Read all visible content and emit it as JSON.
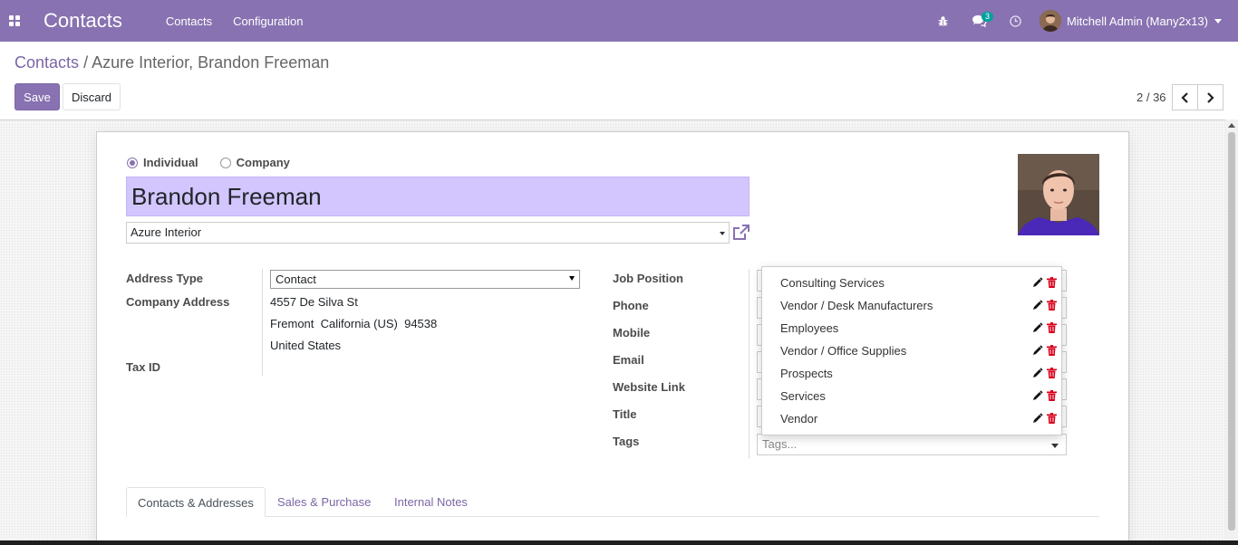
{
  "app": {
    "title": "Contacts",
    "menu": [
      "Contacts",
      "Configuration"
    ],
    "messages_count": "3",
    "user": "Mitchell Admin (Many2x13)"
  },
  "breadcrumb": {
    "root": "Contacts",
    "separator": "/",
    "current": "Azure Interior, Brandon Freeman"
  },
  "buttons": {
    "save": "Save",
    "discard": "Discard"
  },
  "pager": {
    "text": "2 / 36"
  },
  "form": {
    "type_individual": "Individual",
    "type_company": "Company",
    "name": "Brandon Freeman",
    "company": "Azure Interior",
    "address_type_label": "Address Type",
    "address_type_value": "Contact",
    "company_address_label": "Company Address",
    "address_line1": "4557 De Silva St",
    "address_line2": "Fremont  California (US)  94538",
    "address_line3": "United States",
    "tax_id_label": "Tax ID",
    "job_position_label": "Job Position",
    "phone_label": "Phone",
    "mobile_label": "Mobile",
    "email_label": "Email",
    "website_label": "Website Link",
    "title_label": "Title",
    "tags_label": "Tags",
    "tags_placeholder": "Tags..."
  },
  "tags_dropdown": [
    "Consulting Services",
    "Vendor / Desk Manufacturers",
    "Employees",
    "Vendor / Office Supplies",
    "Prospects",
    "Services",
    "Vendor"
  ],
  "tabs": [
    "Contacts & Addresses",
    "Sales & Purchase",
    "Internal Notes"
  ],
  "colors": {
    "brand": "#8872b1",
    "name_field_bg": "#d3c6ff",
    "delete_icon": "#d9001b",
    "badge": "#00a09d"
  }
}
